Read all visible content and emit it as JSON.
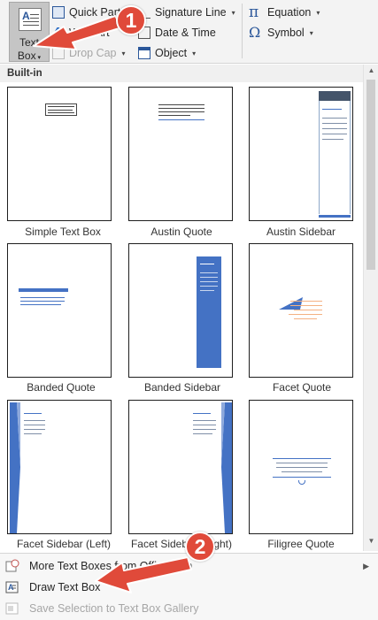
{
  "ribbon": {
    "text_box_label_line1": "Text",
    "text_box_label_line2": "Box",
    "quick_parts": "Quick Parts",
    "wordart": "WordArt",
    "drop_cap": "Drop Cap",
    "signature_line": "Signature Line",
    "date_time": "Date & Time",
    "object": "Object",
    "equation": "Equation",
    "symbol": "Symbol"
  },
  "gallery": {
    "section_header": "Built-in",
    "items": [
      {
        "label": "Simple Text Box"
      },
      {
        "label": "Austin Quote"
      },
      {
        "label": "Austin Sidebar"
      },
      {
        "label": "Banded Quote"
      },
      {
        "label": "Banded Sidebar"
      },
      {
        "label": "Facet Quote"
      },
      {
        "label": "Facet Sidebar (Left)"
      },
      {
        "label": "Facet Sidebar (Right)"
      },
      {
        "label": "Filigree Quote"
      }
    ]
  },
  "menu": {
    "more_text_boxes": "More Text Boxes from Office.com",
    "draw_text_box": "Draw Text Box",
    "save_selection": "Save Selection to Text Box Gallery"
  },
  "annotations": {
    "badge_1": "1",
    "badge_2": "2"
  },
  "colors": {
    "accent_blue": "#4472c4",
    "annotation_red": "#e04a3a",
    "facet_orange": "#ed7d31"
  }
}
